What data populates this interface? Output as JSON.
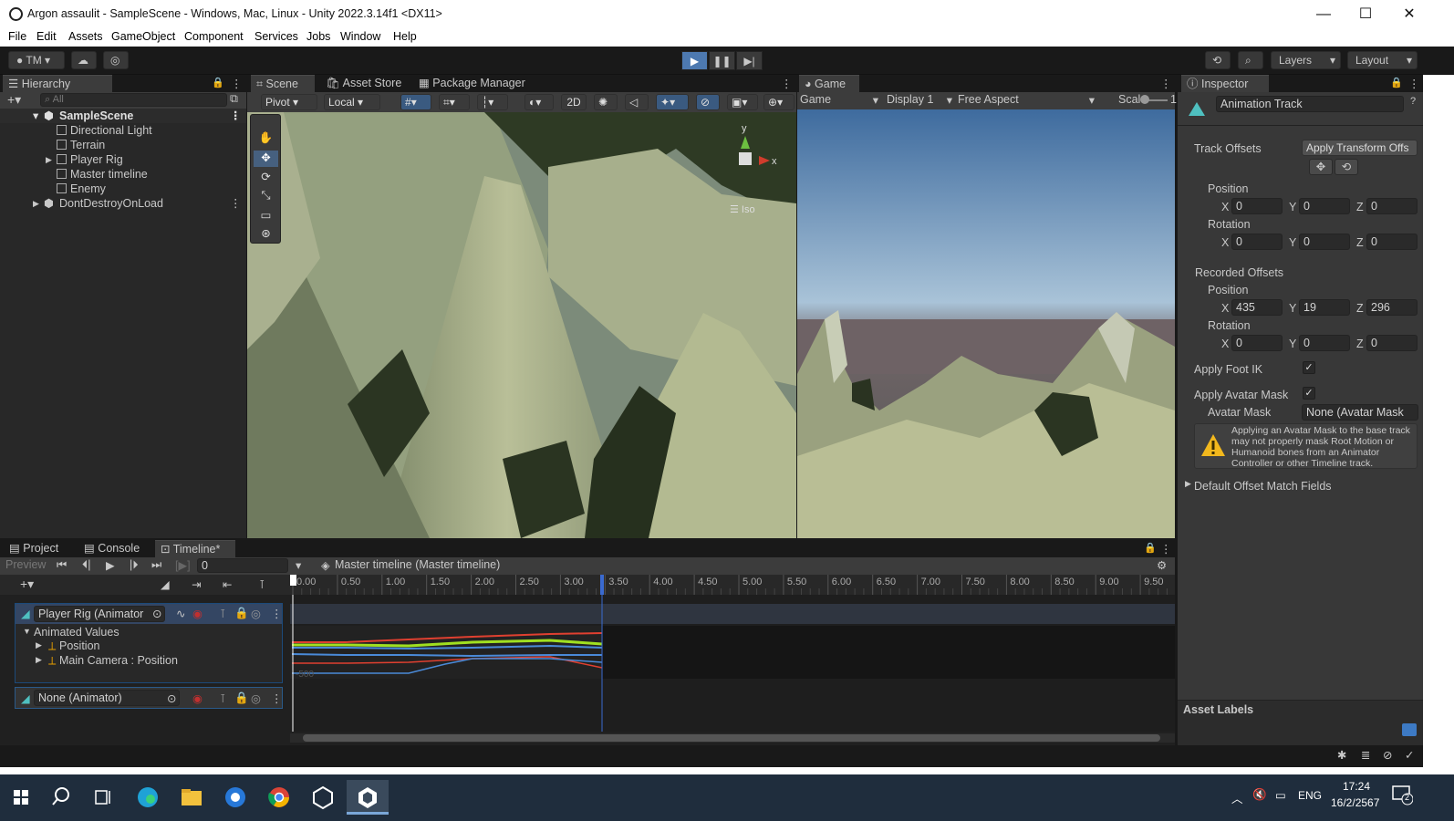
{
  "window": {
    "title": "Argon assaulit - SampleScene - Windows, Mac, Linux - Unity 2022.3.14f1 <DX11>",
    "minimize": "—",
    "maximize": "☐",
    "close": "✕"
  },
  "menu": [
    "File",
    "Edit",
    "Assets",
    "GameObject",
    "Component",
    "Services",
    "Jobs",
    "Window",
    "Help"
  ],
  "toolbar": {
    "account": "TM",
    "layers": "Layers",
    "layout": "Layout"
  },
  "hierarchy": {
    "tab": "Hierarchy",
    "search_placeholder": "All",
    "scene": "SampleScene",
    "items": [
      "Directional Light",
      "Terrain",
      "Player Rig",
      "Master timeline",
      "Enemy"
    ],
    "dontdestroy": "DontDestroyOnLoad"
  },
  "scene_panel": {
    "tabs": [
      "Scene",
      "Asset Store",
      "Package Manager"
    ],
    "pivot": "Pivot",
    "local": "Local",
    "mode2d": "2D",
    "gizmo_axis_y": "y",
    "gizmo_axis_x": "x",
    "iso": "Iso"
  },
  "game_panel": {
    "tab": "Game",
    "view": "Game",
    "display": "Display 1",
    "aspect": "Free Aspect",
    "scale_label": "Scale",
    "scale_value": "1"
  },
  "inspector": {
    "tab": "Inspector",
    "object_name": "Animation Track",
    "track_offsets_label": "Track Offsets",
    "track_offsets_value": "Apply Transform Offs",
    "position_label": "Position",
    "rotation_label": "Rotation",
    "pos": {
      "x": "0",
      "y": "0",
      "z": "0"
    },
    "rot": {
      "x": "0",
      "y": "0",
      "z": "0"
    },
    "recorded_label": "Recorded Offsets",
    "rec_pos": {
      "x": "435",
      "y": "19",
      "z": "296"
    },
    "rec_rot": {
      "x": "0",
      "y": "0",
      "z": "0"
    },
    "x": "X",
    "y": "Y",
    "z": "Z",
    "apply_foot_ik": "Apply Foot IK",
    "apply_avatar_mask": "Apply Avatar Mask",
    "avatar_mask_label": "Avatar Mask",
    "avatar_mask_value": "None (Avatar Mask",
    "warning": "Applying an Avatar Mask to the base track may not properly mask Root Motion or Humanoid bones from an Animator Controller or other Timeline track.",
    "default_offset": "Default Offset Match Fields",
    "asset_labels": "Asset Labels"
  },
  "bottom": {
    "tabs": [
      "Project",
      "Console",
      "Timeline*"
    ],
    "preview": "Preview",
    "frame": "0",
    "breadcrumb": "Master timeline (Master timeline)",
    "ruler": [
      "0.00",
      "0.50",
      "1.00",
      "1.50",
      "2.00",
      "2.50",
      "3.00",
      "3.50",
      "4.00",
      "4.50",
      "5.00",
      "5.50",
      "6.00",
      "6.50",
      "7.00",
      "7.50",
      "8.00",
      "8.50",
      "9.00",
      "9.50"
    ],
    "track1": "Player Rig (Animator",
    "animated_values": "Animated Values",
    "position": "Position",
    "camera_position": "Main Camera : Position",
    "track2": "None (Animator)",
    "curve_label": "-500"
  },
  "taskbar": {
    "lang": "ENG",
    "time": "17:24",
    "date": "16/2/2567",
    "notif_count": "2"
  }
}
